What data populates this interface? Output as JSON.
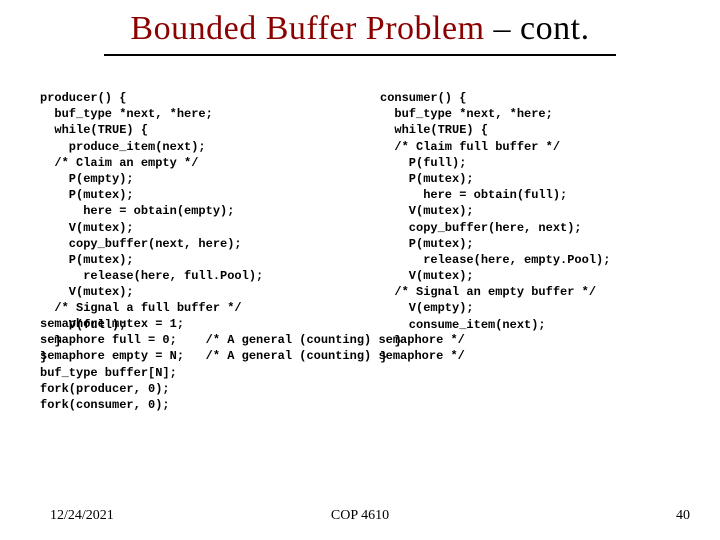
{
  "title": {
    "main": "Bounded Buffer Problem",
    "suffix": " – cont."
  },
  "code": {
    "producer": "producer() {\n  buf_type *next, *here;\n  while(TRUE) {\n    produce_item(next);\n  /* Claim an empty */\n    P(empty);\n    P(mutex);\n      here = obtain(empty);\n    V(mutex);\n    copy_buffer(next, here);\n    P(mutex);\n      release(here, full.Pool);\n    V(mutex);\n  /* Signal a full buffer */\n    V(full);\n  }\n}",
    "consumer": "consumer() {\n  buf_type *next, *here;\n  while(TRUE) {\n  /* Claim full buffer */\n    P(full);\n    P(mutex);\n      here = obtain(full);\n    V(mutex);\n    copy_buffer(here, next);\n    P(mutex);\n      release(here, empty.Pool);\n    V(mutex);\n  /* Signal an empty buffer */\n    V(empty);\n    consume_item(next);\n  }\n}",
    "declarations": "semaphore mutex = 1;\nsemaphore full = 0;    /* A general (counting) semaphore */\nsemaphore empty = N;   /* A general (counting) semaphore */\nbuf_type buffer[N];\nfork(producer, 0);\nfork(consumer, 0);"
  },
  "footer": {
    "date": "12/24/2021",
    "course": "COP 4610",
    "page": "40"
  }
}
